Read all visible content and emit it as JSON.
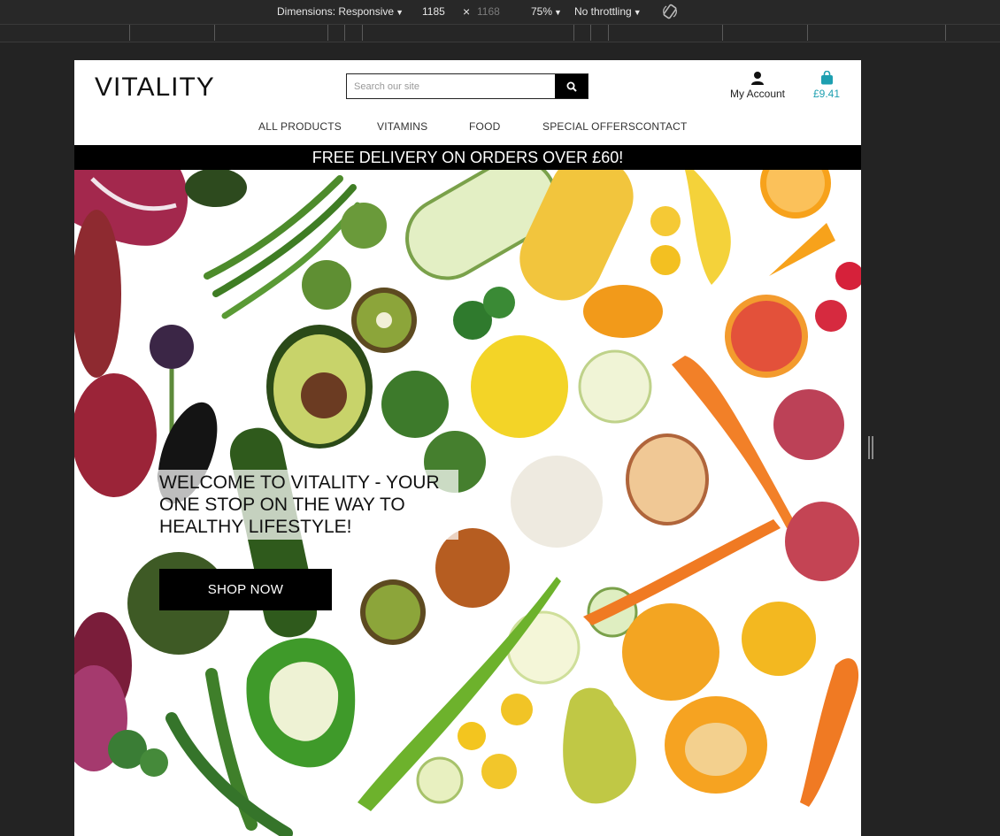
{
  "devtools": {
    "dimensions_label": "Dimensions: Responsive",
    "width": "1185",
    "times": "×",
    "height": "1168",
    "zoom": "75%",
    "throttling": "No throttling"
  },
  "site": {
    "logo": "VITALITY",
    "search": {
      "placeholder": "Search our site",
      "icon": "search-icon"
    },
    "account": {
      "label": "My Account",
      "icon": "user-icon"
    },
    "cart": {
      "total": "£9.41",
      "icon": "shopping-bag-icon",
      "color": "#1d9fb0"
    },
    "nav": [
      "ALL PRODUCTS",
      "VITAMINS",
      "FOOD",
      "SPECIAL OFFERS",
      "CONTACT"
    ],
    "promo": "FREE DELIVERY ON ORDERS OVER £60!",
    "hero": {
      "headline_lines": [
        "WELCOME TO VITALITY - YOUR",
        "ONE STOP ON THE WAY TO",
        "HEALTHY LIFESTYLE!"
      ],
      "cta": "SHOP NOW"
    }
  }
}
